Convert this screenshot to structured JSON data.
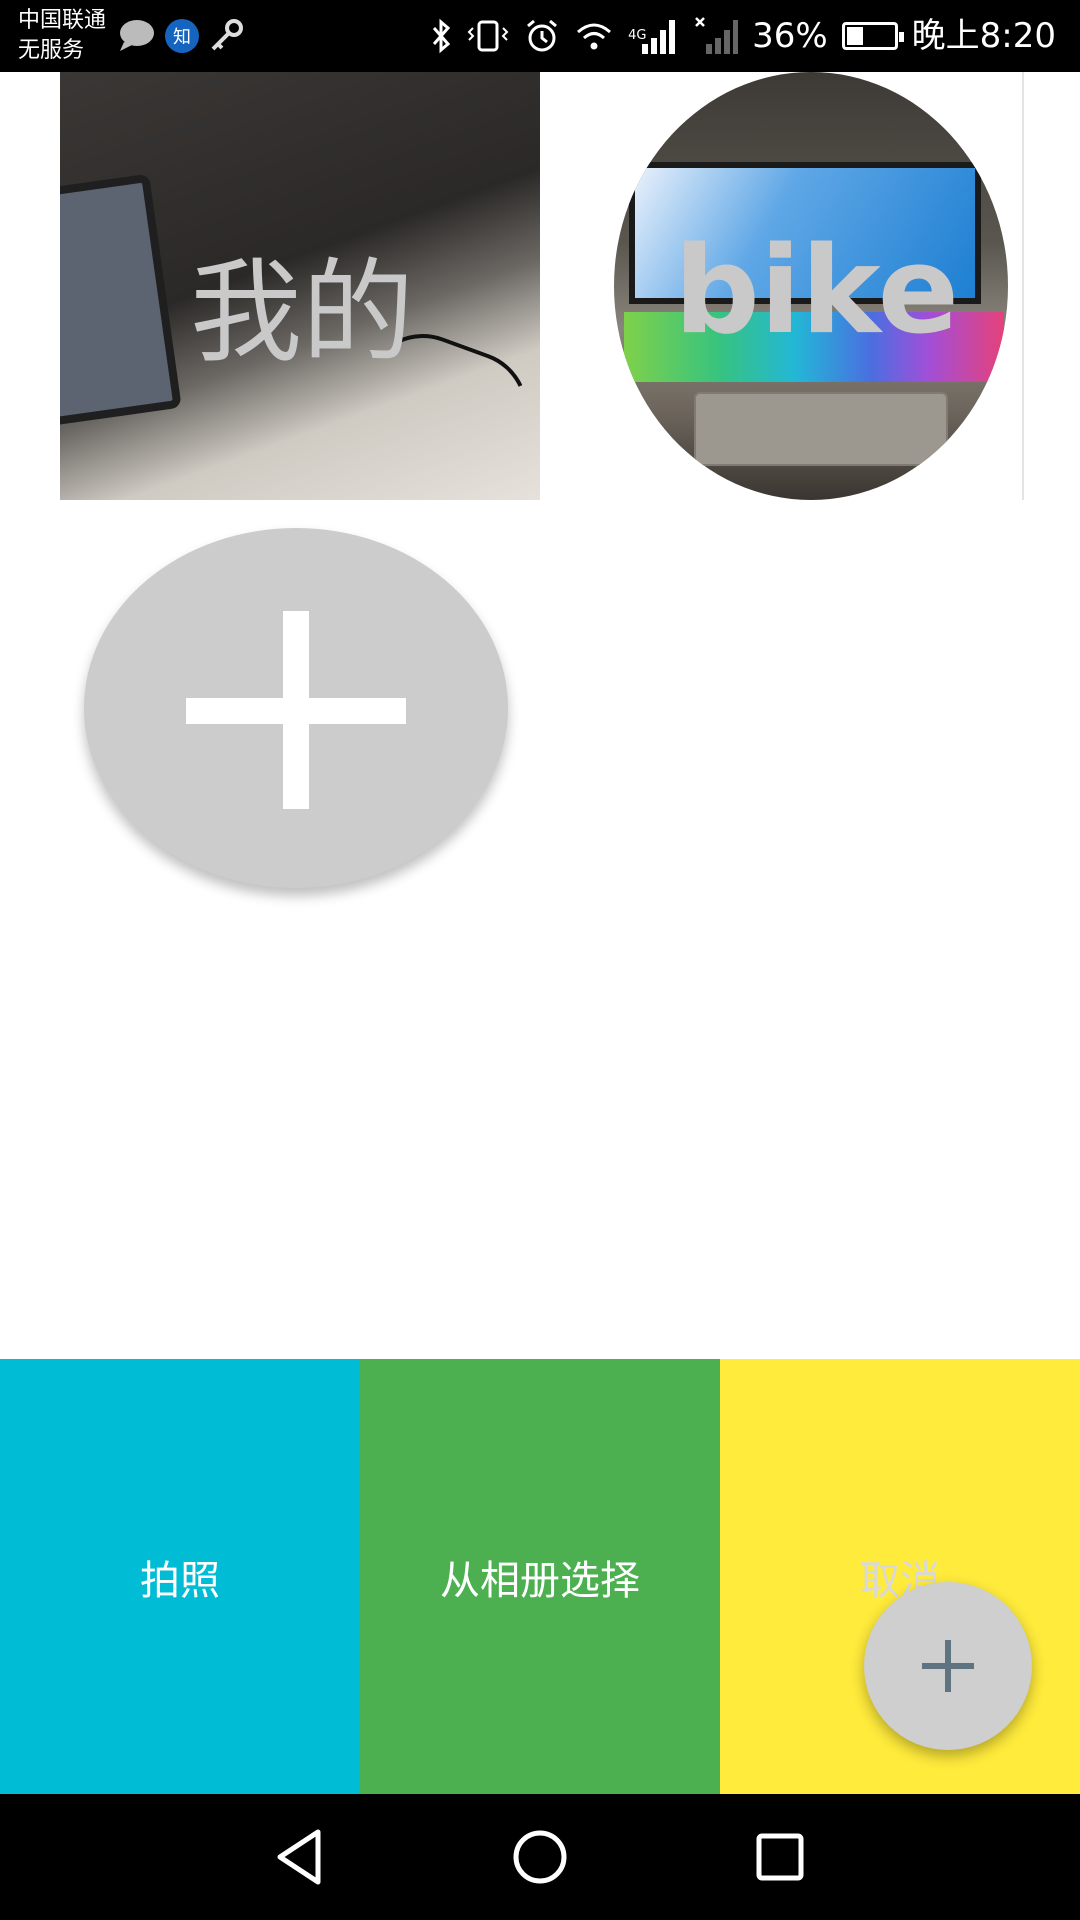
{
  "status_bar": {
    "carrier_line1": "中国联通",
    "carrier_line2": "无服务",
    "notification_icons": [
      "chat-bubble-icon",
      "zhihu-icon",
      "key-icon"
    ],
    "zhihu_glyph": "知",
    "network_type": "4G",
    "battery_percent": "36%",
    "battery_level": 0.36,
    "time": "晚上8:20"
  },
  "gallery": {
    "items": [
      {
        "label": "我的"
      },
      {
        "label": "bike"
      }
    ],
    "add_icon": "plus-icon"
  },
  "actions": {
    "take_photo": "拍照",
    "choose_from_album": "从相册选择",
    "cancel": "取消"
  },
  "fab": {
    "icon": "plus-icon"
  },
  "nav_bar": {
    "icons": [
      "back-icon",
      "home-icon",
      "recents-icon"
    ]
  },
  "colors": {
    "take_photo_bg": "#00bcd4",
    "album_bg": "#4caf50",
    "cancel_bg": "#ffeb3b",
    "fab_bg": "#cfcfcf",
    "add_circle_bg": "#cccccc"
  }
}
